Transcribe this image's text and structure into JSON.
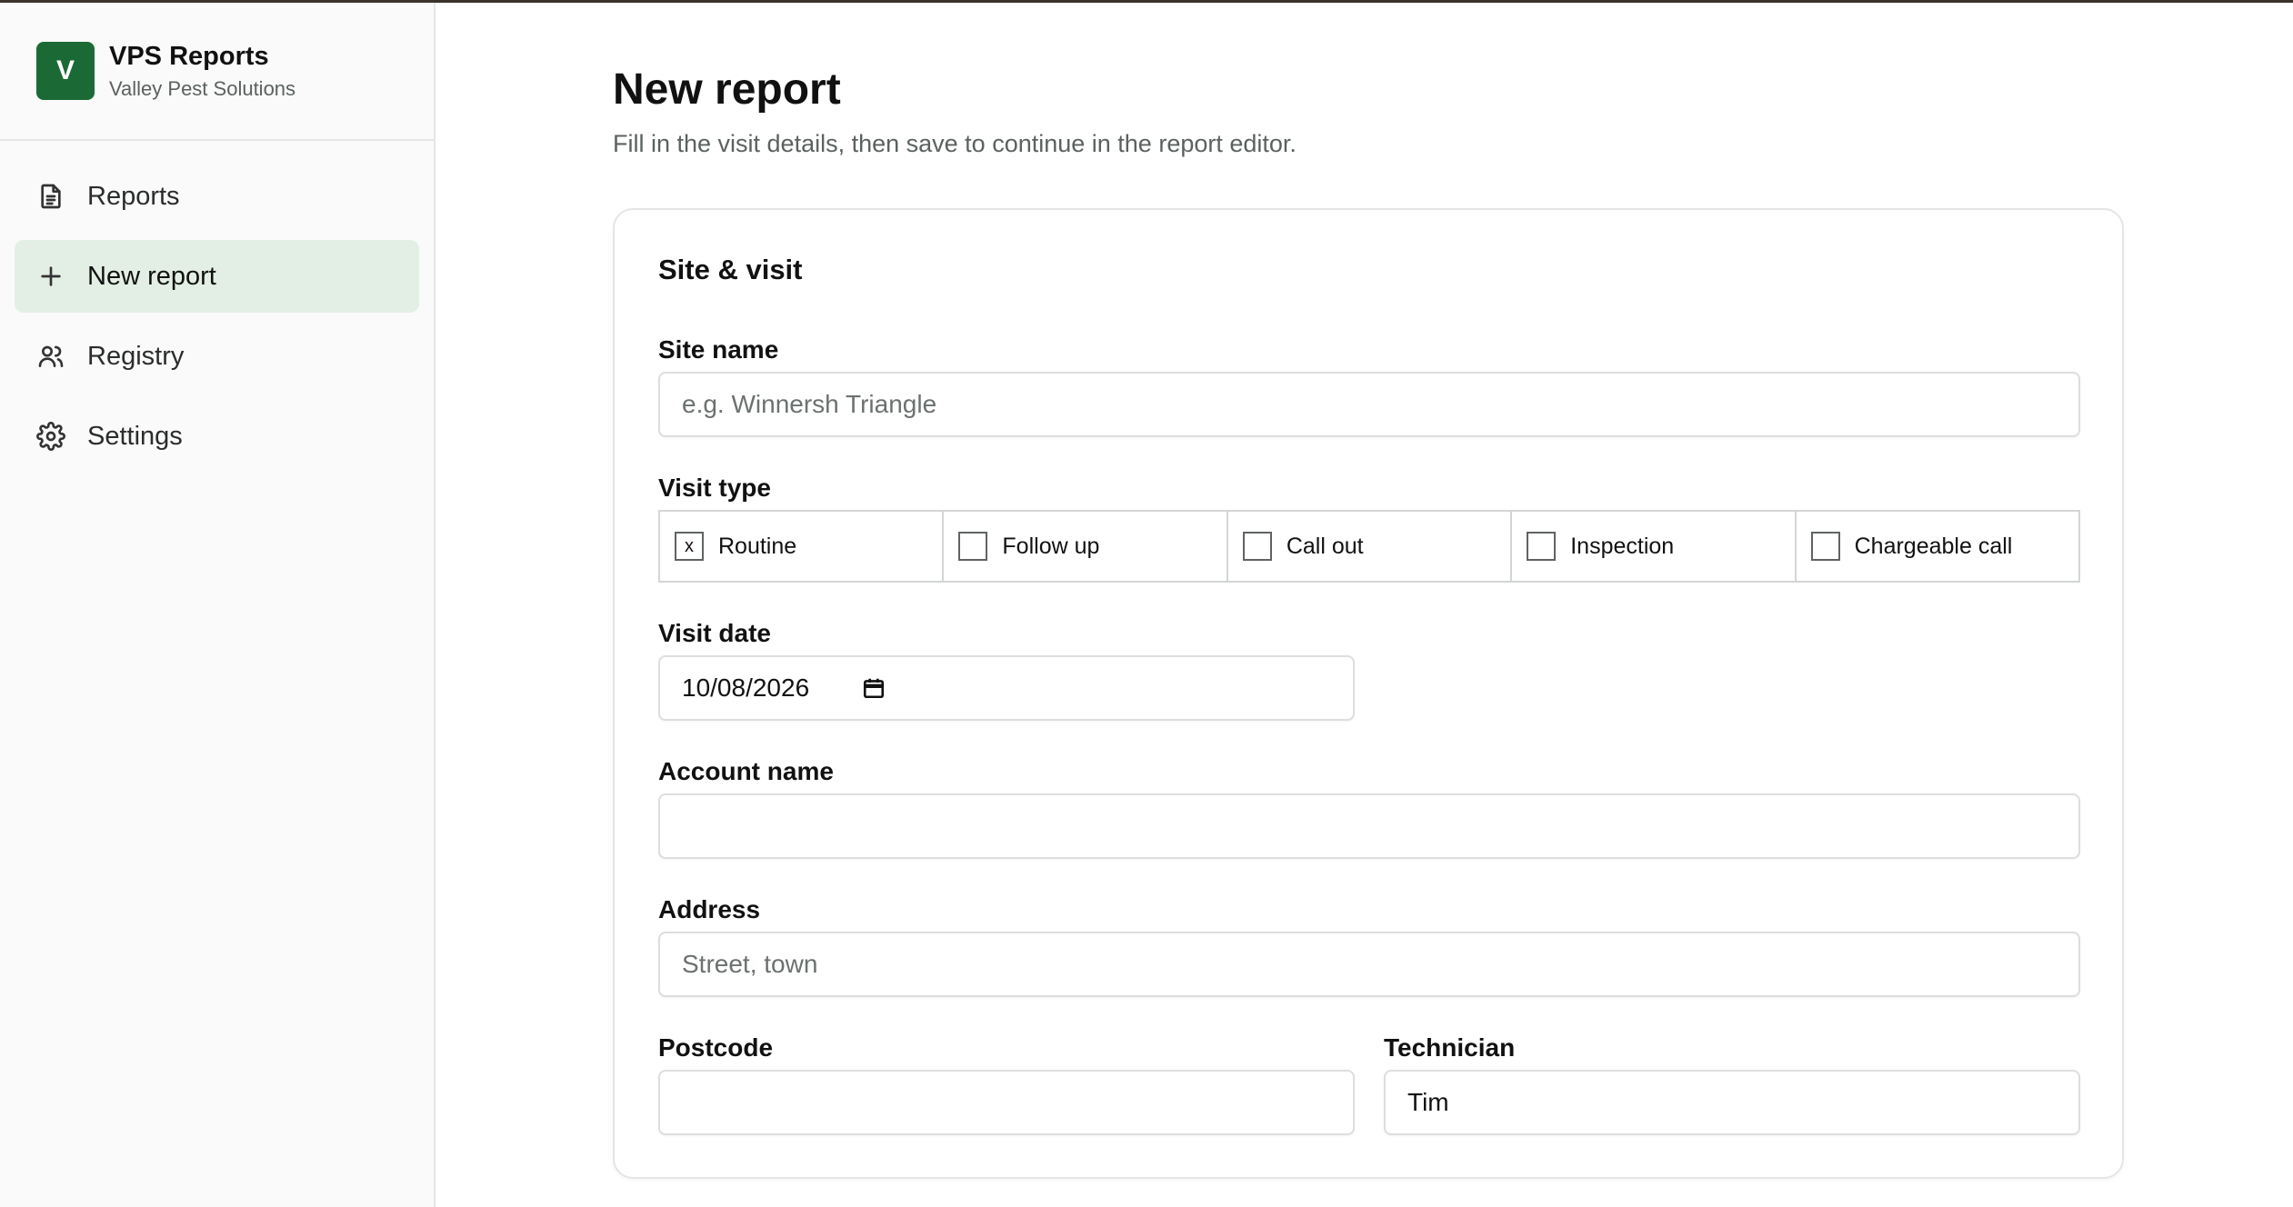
{
  "brand": {
    "logo_letter": "V",
    "title": "VPS Reports",
    "subtitle": "Valley Pest Solutions"
  },
  "sidebar": {
    "items": [
      {
        "label": "Reports",
        "icon": "document-icon",
        "active": false
      },
      {
        "label": "New report",
        "icon": "plus-icon",
        "active": true
      },
      {
        "label": "Registry",
        "icon": "users-icon",
        "active": false
      },
      {
        "label": "Settings",
        "icon": "gear-icon",
        "active": false
      }
    ]
  },
  "page": {
    "title": "New report",
    "subtitle": "Fill in the visit details, then save to continue in the report editor."
  },
  "card": {
    "title": "Site & visit",
    "site_name": {
      "label": "Site name",
      "value": "",
      "placeholder": "e.g. Winnersh Triangle"
    },
    "visit_type": {
      "label": "Visit type",
      "options": [
        {
          "label": "Routine",
          "checked": true,
          "mark": "x"
        },
        {
          "label": "Follow up",
          "checked": false,
          "mark": ""
        },
        {
          "label": "Call out",
          "checked": false,
          "mark": ""
        },
        {
          "label": "Inspection",
          "checked": false,
          "mark": ""
        },
        {
          "label": "Chargeable call",
          "checked": false,
          "mark": ""
        }
      ]
    },
    "visit_date": {
      "label": "Visit date",
      "value": "10/08/2026"
    },
    "account_name": {
      "label": "Account name",
      "value": "",
      "placeholder": ""
    },
    "address": {
      "label": "Address",
      "value": "",
      "placeholder": "Street, town"
    },
    "postcode": {
      "label": "Postcode",
      "value": "",
      "placeholder": ""
    },
    "technician": {
      "label": "Technician",
      "value": "Tim"
    }
  },
  "colors": {
    "brand_green": "#1b6a35",
    "active_nav_bg": "#e3efe5"
  }
}
